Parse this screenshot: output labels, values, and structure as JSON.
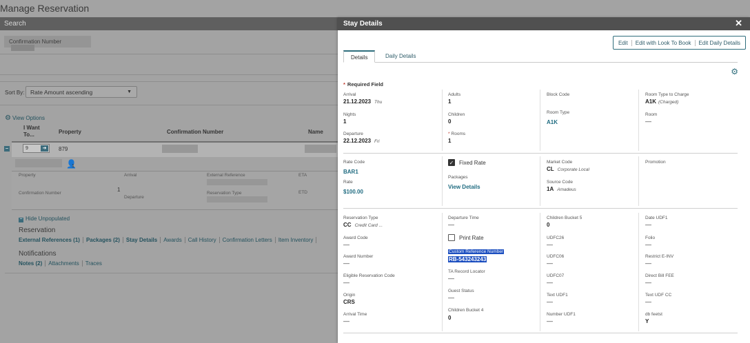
{
  "page": {
    "title": "Manage Reservation",
    "search_label": "Search"
  },
  "search": {
    "confirmation_label": "Confirmation Number"
  },
  "sort": {
    "label": "Sort By:",
    "value": "Rate Amount ascending"
  },
  "view_options": "View Options",
  "results_headers": {
    "i_want": "I Want To...",
    "property": "Property",
    "confirmation": "Confirmation Number",
    "name": "Name"
  },
  "row": {
    "i_want_value": "9",
    "property_value": "879",
    "guests": "1"
  },
  "row_details": {
    "property_label": "Property",
    "arrival_label": "Arrival",
    "arrival_value": "1",
    "departure_label": "Departure",
    "external_ref_label": "External Reference",
    "eta_label": "ETA",
    "confirmation_label": "Confirmation Number",
    "reservation_type_label": "Reservation Type",
    "etd_label": "ETD"
  },
  "hide_unpopulated": "Hide Unpopulated",
  "reservation_section": "Reservation",
  "reservation_links": [
    "External References (1)",
    "Packages (2)",
    "Stay Details",
    "Awards",
    "Call History",
    "Confirmation Letters",
    "Item Inventory"
  ],
  "notifications_section": "Notifications",
  "notification_links": [
    "Notes (2)",
    "Attachments",
    "Traces"
  ],
  "dialog": {
    "title": "Stay Details",
    "actions": [
      "Edit",
      "Edit with Look To Book",
      "Edit Daily Details"
    ],
    "tabs": [
      "Details",
      "Daily Details"
    ],
    "required_field": "Required Field",
    "s1": {
      "arrival_label": "Arrival",
      "arrival_value": "21.12.2023",
      "arrival_day": "Thu",
      "nights_label": "Nights",
      "nights_value": "1",
      "departure_label": "Departure",
      "departure_value": "22.12.2023",
      "departure_day": "Fri",
      "adults_label": "Adults",
      "adults_value": "1",
      "children_label": "Children",
      "children_value": "0",
      "rooms_label": "Rooms",
      "rooms_value": "1",
      "block_code_label": "Block Code",
      "room_type_label": "Room Type",
      "room_type_value": "A1K",
      "rtc_label": "Room Type to Charge",
      "rtc_value": "A1K",
      "rtc_note": "(Charged)",
      "room_label": "Room",
      "room_value": "—"
    },
    "s2": {
      "rate_code_label": "Rate Code",
      "rate_code_value": "BAR1",
      "rate_label": "Rate",
      "rate_value": "$100.00",
      "fixed_rate": "Fixed Rate",
      "packages_label": "Packages",
      "view_details": "View Details",
      "market_code_label": "Market Code",
      "market_code_value": "CL",
      "market_code_desc": "Corporate Local",
      "source_code_label": "Source Code",
      "source_code_value": "1A",
      "source_code_desc": "Amadeus",
      "promotion_label": "Promotion"
    },
    "s3": {
      "col1": [
        {
          "label": "Reservation Type",
          "value": "CC",
          "desc": "Credit Card ..."
        },
        {
          "label": "Award Code",
          "value": "—"
        },
        {
          "label": "Award Number",
          "value": "—"
        },
        {
          "label": "Eligible Reservation Code",
          "value": "—"
        },
        {
          "label": "Origin",
          "value": "CRS"
        },
        {
          "label": "Arrival Time",
          "value": "—"
        }
      ],
      "col2": {
        "departure_time_label": "Departure Time",
        "departure_time_value": "—",
        "print_rate": "Print Rate",
        "custom_ref_label": "Custom Reference Number",
        "custom_ref_value": "RB-543243243",
        "ta_record_label": "TA Record Locator",
        "ta_record_value": "—",
        "guest_status_label": "Guest Status",
        "guest_status_value": "—",
        "children_bucket4_label": "Children Bucket 4",
        "children_bucket4_value": "0"
      },
      "col3": [
        {
          "label": "Children Bucket 5",
          "value": "0"
        },
        {
          "label": "UDFC26",
          "value": "—"
        },
        {
          "label": "UDFC06",
          "value": "—"
        },
        {
          "label": "UDFC07",
          "value": "—"
        },
        {
          "label": "Text UDF1",
          "value": "—"
        },
        {
          "label": "Number UDF1",
          "value": "—"
        }
      ],
      "col4": [
        {
          "label": "Date UDF1",
          "value": "—"
        },
        {
          "label": "Folio",
          "value": "—"
        },
        {
          "label": "Restrict E-INV",
          "value": "—"
        },
        {
          "label": "Direct Bill FEE",
          "value": "—"
        },
        {
          "label": "Text UDF CC",
          "value": "—"
        },
        {
          "label": "db feetst",
          "value": "Y"
        }
      ]
    }
  }
}
